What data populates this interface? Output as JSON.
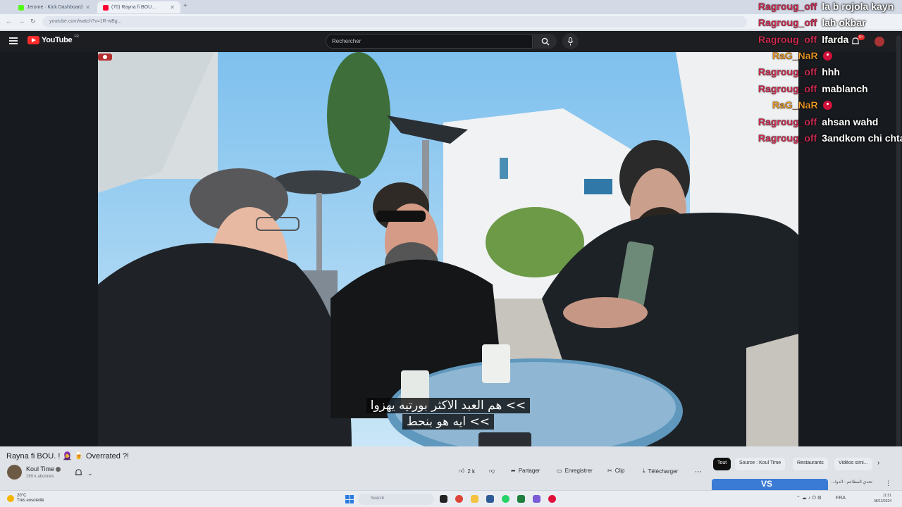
{
  "browser": {
    "tabs": [
      {
        "label": "Jerome · Kick Dashboard",
        "active": false,
        "favicon_color": "#53fc18"
      },
      {
        "label": "(70) Rayna fi BOU...",
        "active": true,
        "favicon_color": "#ff0033"
      }
    ],
    "new_tab": "+",
    "url": "youtube.com/watch?v=1R-wBg..."
  },
  "youtube": {
    "logo": "YouTube",
    "country_code": "FR",
    "search_placeholder": "Rechercher",
    "notification_count": "9+"
  },
  "chat": {
    "messages": [
      {
        "user": "Ragroug_off",
        "text": "la b rojola kayn",
        "alt": false
      },
      {
        "user": "Ragroug_off",
        "text": "lah okbar",
        "alt": false
      },
      {
        "user": "Ragroug_off",
        "text": "lfarda",
        "alt": false
      },
      {
        "user": "RaG_NaR",
        "text": "",
        "alt": true,
        "emoji": "red-emote"
      },
      {
        "user": "Ragroug_off",
        "text": "hhh",
        "alt": false
      },
      {
        "user": "Ragroug_off",
        "text": "mablanch",
        "alt": false
      },
      {
        "user": "RaG_NaR",
        "text": "",
        "alt": true,
        "emoji": "red-emote"
      },
      {
        "user": "Ragroug_off",
        "text": "ahsan wahd",
        "alt": false
      },
      {
        "user": "Ragroug_off",
        "text": "3andkom chi chta",
        "alt": false
      }
    ]
  },
  "video": {
    "subtitles": [
      ">> هم العبد الاكثر بورتيه يهزوا",
      ">> ايه هو بنحط"
    ]
  },
  "below": {
    "title": "Rayna fi BOU. ! 🧕 🍺 Overrated ?!",
    "channel": "Koul Time",
    "subscribers": "169 k abonnés",
    "actions": {
      "like": "2 k",
      "share": "Partager",
      "save": "Enregistrer",
      "clip": "Clip",
      "download": "Télécharger"
    },
    "chips": [
      "Tout",
      "Source : Koul Time",
      "Restaurants",
      "Vidéos simi..."
    ],
    "recommendation": {
      "thumb_text": "VS",
      "title": "تحدي المطاعم - الدوا..."
    }
  },
  "taskbar": {
    "weather_temp": "20°C",
    "weather_desc": "Très ensoleillé",
    "search_placeholder": "Search",
    "language": "FRA",
    "language_sub": "FR",
    "time": "11:51",
    "date": "08/12/2024"
  }
}
